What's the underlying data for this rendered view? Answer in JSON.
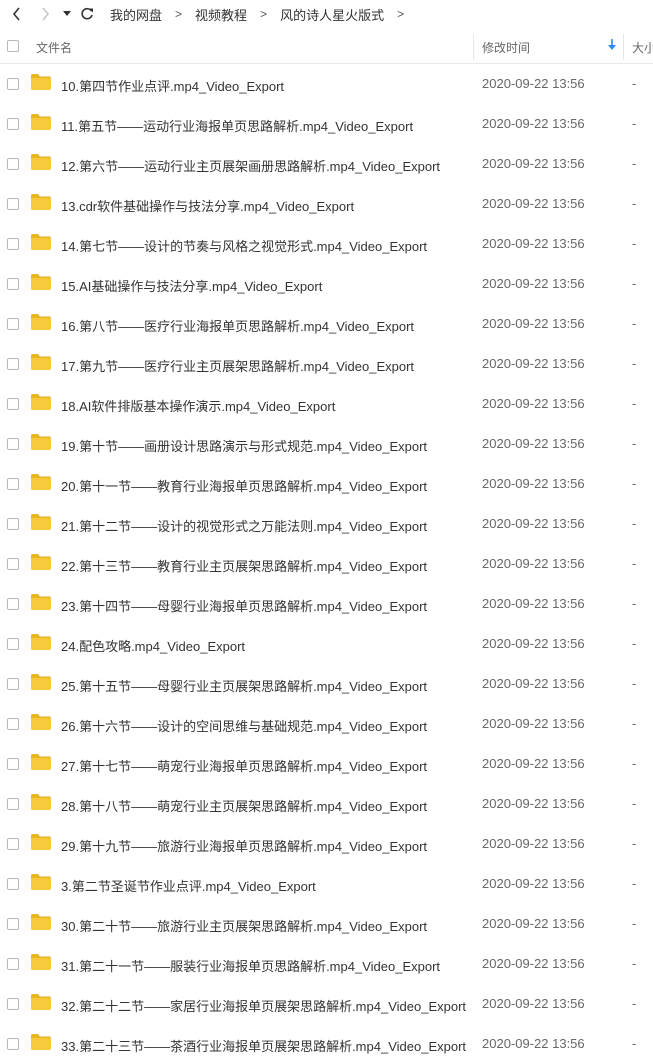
{
  "breadcrumb": [
    "我的网盘",
    "视频教程",
    "风的诗人星火版式"
  ],
  "breadcrumb_separator": ">",
  "columns": {
    "name": "文件名",
    "modified": "修改时间",
    "size": "大小"
  },
  "colors": {
    "folder": "#f8c93a",
    "folder_dark": "#e9b420",
    "sort_arrow": "#2f8cf0"
  },
  "files": [
    {
      "name": "10.第四节作业点评.mp4_Video_Export",
      "time": "2020-09-22 13:56",
      "size": "-"
    },
    {
      "name": "11.第五节——运动行业海报单页思路解析.mp4_Video_Export",
      "time": "2020-09-22 13:56",
      "size": "-"
    },
    {
      "name": "12.第六节——运动行业主页展架画册思路解析.mp4_Video_Export",
      "time": "2020-09-22 13:56",
      "size": "-"
    },
    {
      "name": "13.cdr软件基础操作与技法分享.mp4_Video_Export",
      "time": "2020-09-22 13:56",
      "size": "-"
    },
    {
      "name": "14.第七节——设计的节奏与风格之视觉形式.mp4_Video_Export",
      "time": "2020-09-22 13:56",
      "size": "-"
    },
    {
      "name": "15.AI基础操作与技法分享.mp4_Video_Export",
      "time": "2020-09-22 13:56",
      "size": "-"
    },
    {
      "name": "16.第八节——医疗行业海报单页思路解析.mp4_Video_Export",
      "time": "2020-09-22 13:56",
      "size": "-"
    },
    {
      "name": "17.第九节——医疗行业主页展架思路解析.mp4_Video_Export",
      "time": "2020-09-22 13:56",
      "size": "-"
    },
    {
      "name": "18.AI软件排版基本操作演示.mp4_Video_Export",
      "time": "2020-09-22 13:56",
      "size": "-"
    },
    {
      "name": "19.第十节——画册设计思路演示与形式规范.mp4_Video_Export",
      "time": "2020-09-22 13:56",
      "size": "-"
    },
    {
      "name": "20.第十一节——教育行业海报单页思路解析.mp4_Video_Export",
      "time": "2020-09-22 13:56",
      "size": "-"
    },
    {
      "name": "21.第十二节——设计的视觉形式之万能法则.mp4_Video_Export",
      "time": "2020-09-22 13:56",
      "size": "-"
    },
    {
      "name": "22.第十三节——教育行业主页展架思路解析.mp4_Video_Export",
      "time": "2020-09-22 13:56",
      "size": "-"
    },
    {
      "name": "23.第十四节——母婴行业海报单页思路解析.mp4_Video_Export",
      "time": "2020-09-22 13:56",
      "size": "-"
    },
    {
      "name": "24.配色攻略.mp4_Video_Export",
      "time": "2020-09-22 13:56",
      "size": "-"
    },
    {
      "name": "25.第十五节——母婴行业主页展架思路解析.mp4_Video_Export",
      "time": "2020-09-22 13:56",
      "size": "-"
    },
    {
      "name": "26.第十六节——设计的空间思维与基础规范.mp4_Video_Export",
      "time": "2020-09-22 13:56",
      "size": "-"
    },
    {
      "name": "27.第十七节——萌宠行业海报单页思路解析.mp4_Video_Export",
      "time": "2020-09-22 13:56",
      "size": "-"
    },
    {
      "name": "28.第十八节——萌宠行业主页展架思路解析.mp4_Video_Export",
      "time": "2020-09-22 13:56",
      "size": "-"
    },
    {
      "name": "29.第十九节——旅游行业海报单页思路解析.mp4_Video_Export",
      "time": "2020-09-22 13:56",
      "size": "-"
    },
    {
      "name": "3.第二节圣诞节作业点评.mp4_Video_Export",
      "time": "2020-09-22 13:56",
      "size": "-"
    },
    {
      "name": "30.第二十节——旅游行业主页展架思路解析.mp4_Video_Export",
      "time": "2020-09-22 13:56",
      "size": "-"
    },
    {
      "name": "31.第二十一节——服装行业海报单页思路解析.mp4_Video_Export",
      "time": "2020-09-22 13:56",
      "size": "-"
    },
    {
      "name": "32.第二十二节——家居行业海报单页展架思路解析.mp4_Video_Export",
      "time": "2020-09-22 13:56",
      "size": "-"
    },
    {
      "name": "33.第二十三节——茶酒行业海报单页展架思路解析.mp4_Video_Export",
      "time": "2020-09-22 13:56",
      "size": "-"
    }
  ]
}
